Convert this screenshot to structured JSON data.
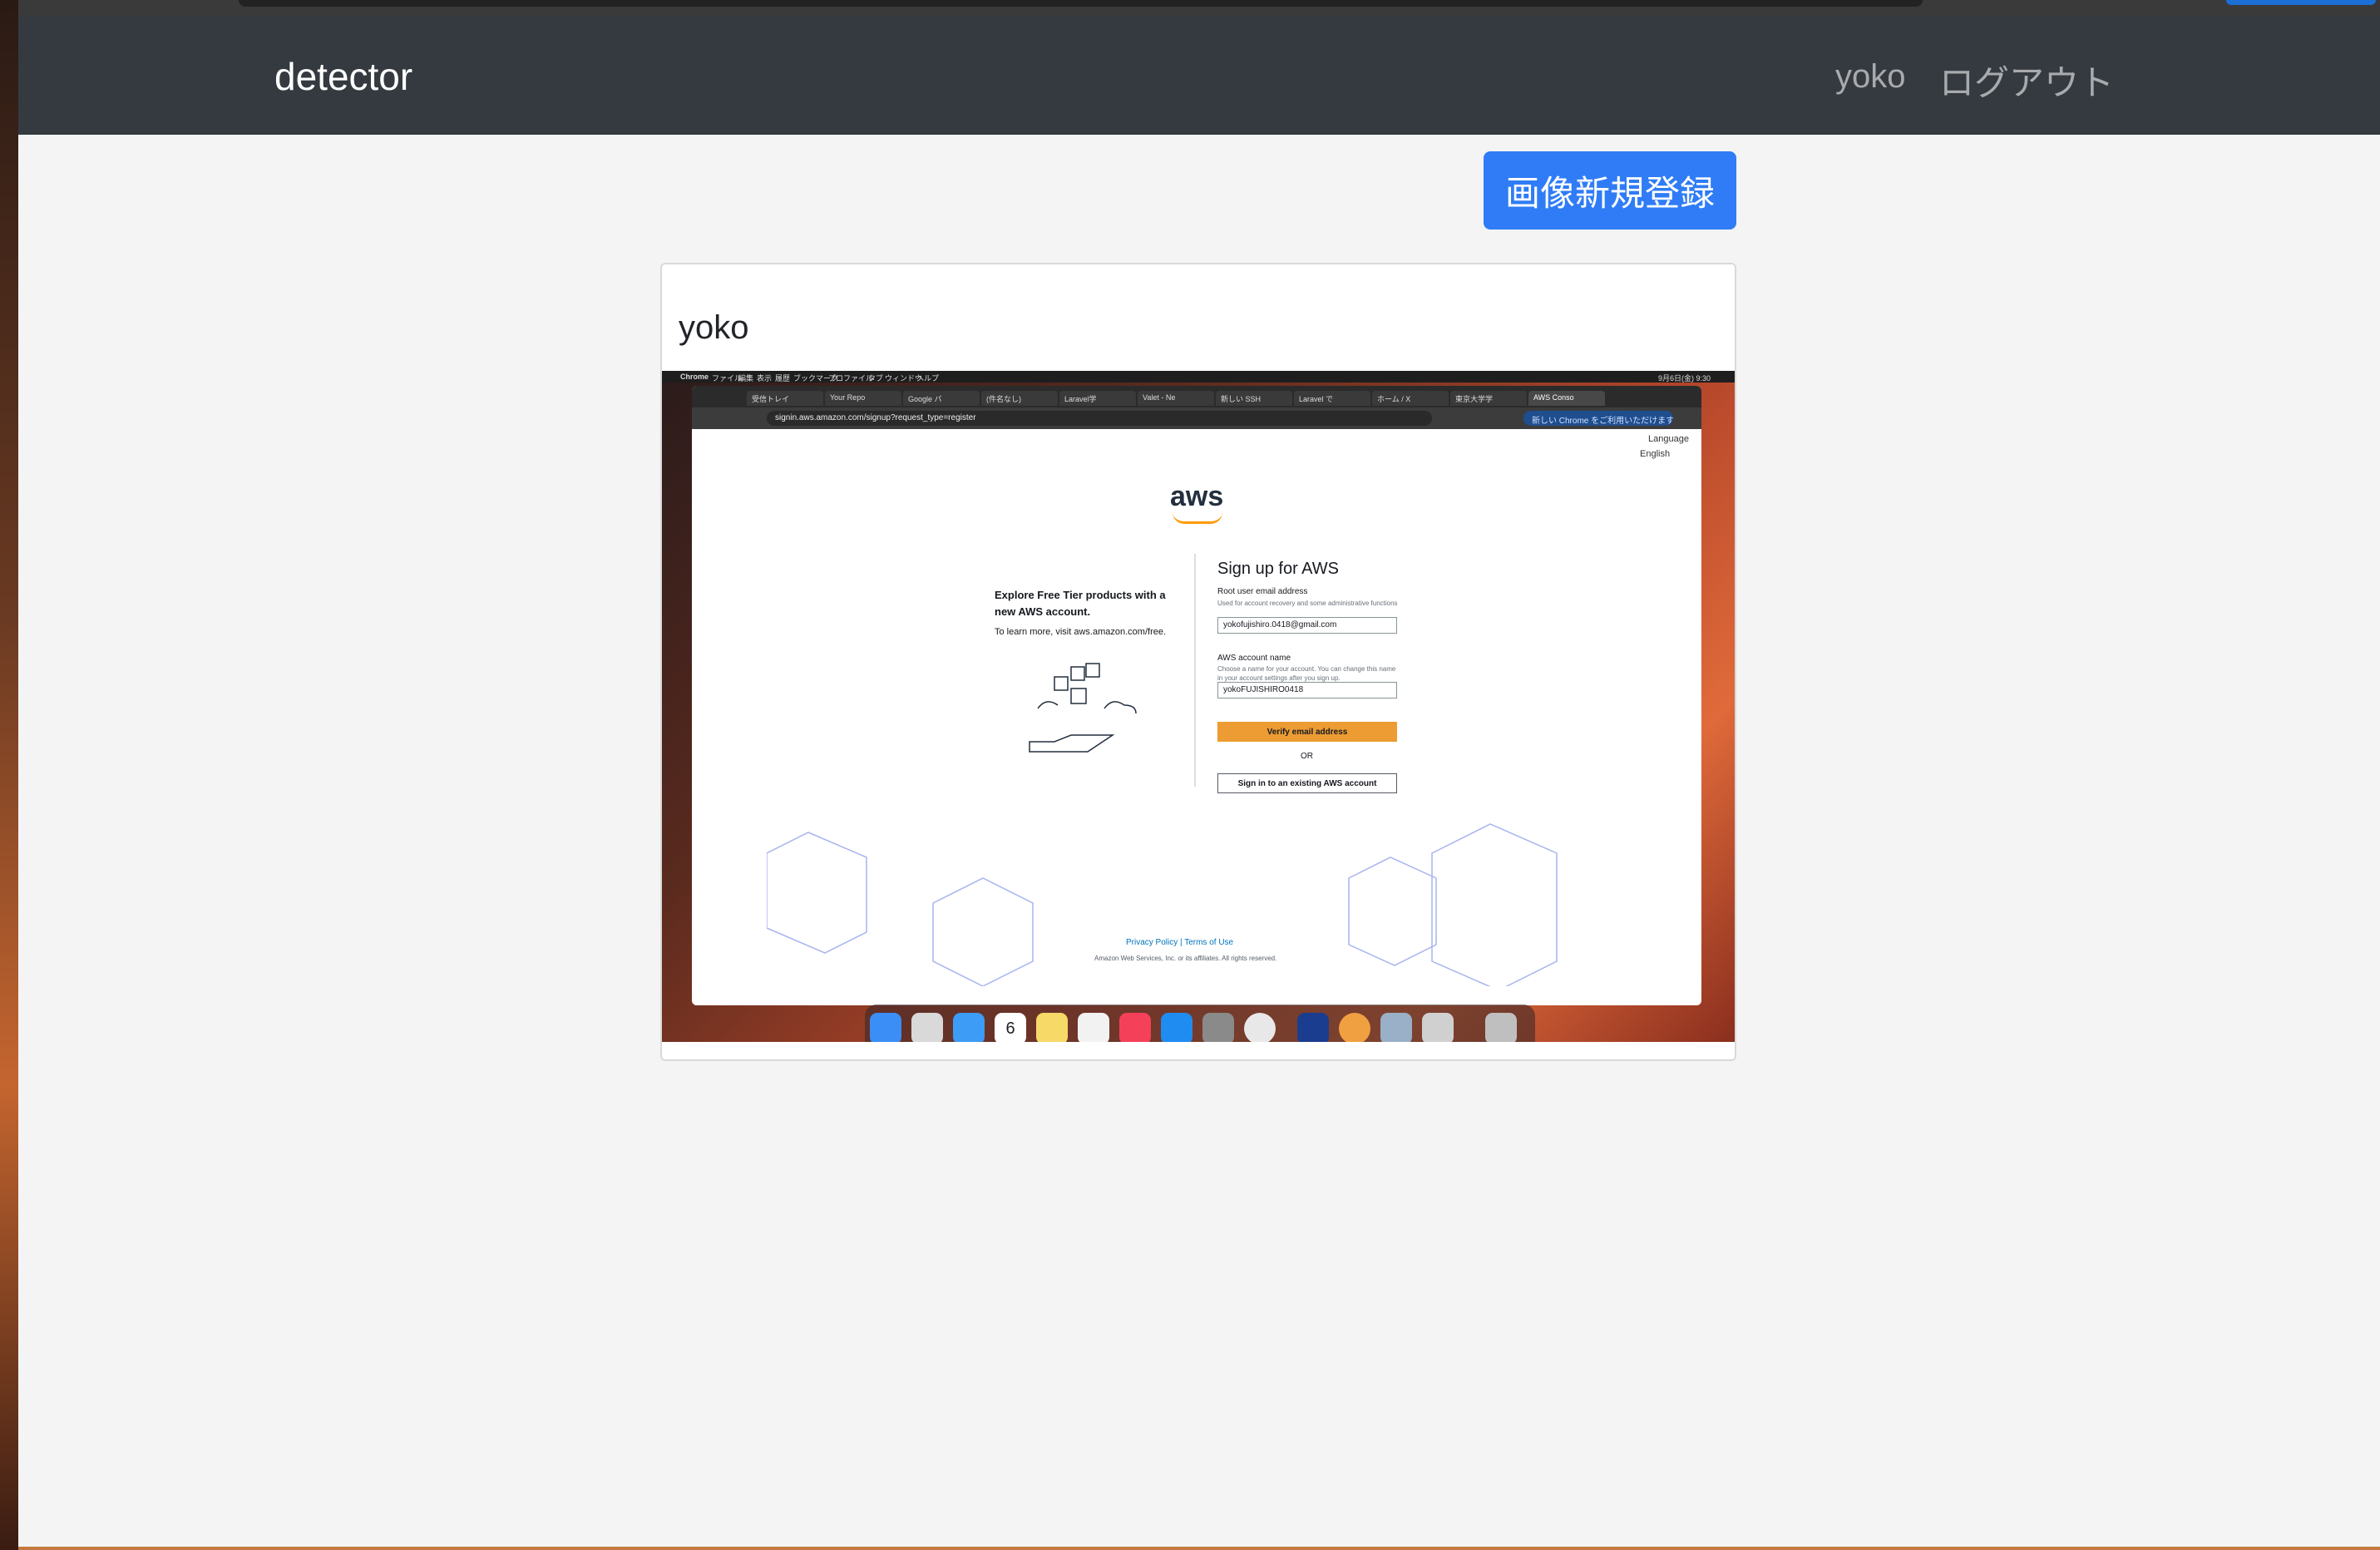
{
  "navbar": {
    "brand": "detector",
    "user": "yoko",
    "logout": "ログアウト"
  },
  "actions": {
    "new_image": "画像新規登録"
  },
  "post": {
    "title": "yoko"
  },
  "embedded": {
    "menubar": {
      "app": "Chrome",
      "items": [
        "ファイル",
        "編集",
        "表示",
        "履歴",
        "ブックマーク",
        "プロファイル",
        "タブ",
        "ウィンドウ",
        "ヘルプ"
      ],
      "clock": "9月6日(金) 9:30"
    },
    "tabs": [
      "受信トレイ",
      "Your Repo",
      "Google バ",
      "(件名なし)",
      "Laravel学",
      "Valet - Ne",
      "新しい SSH",
      "Laravel で",
      "ホーム / X",
      "東京大学学",
      "AWS Conso"
    ],
    "url": "signin.aws.amazon.com/signup?request_type=register",
    "update_notice": "新しい Chrome をご利用いただけます",
    "language_label": "Language",
    "language_value": "English",
    "aws_logo": "aws",
    "promo_heading": "Explore Free Tier products with a new AWS account.",
    "promo_sub": "To learn more, visit aws.amazon.com/free.",
    "signup_title": "Sign up for AWS",
    "email_label": "Root user email address",
    "email_help": "Used for account recovery and some administrative functions",
    "email_value": "yokofujishiro.0418@gmail.com",
    "account_label": "AWS account name",
    "account_help": "Choose a name for your account. You can change this name in your account settings after you sign up.",
    "account_value": "yokoFUJISHIRO0418",
    "verify_button": "Verify email address",
    "or": "OR",
    "signin_button": "Sign in to an existing AWS account",
    "footer_links": "Privacy Policy  |  Terms of Use",
    "footer_copy": "Amazon Web Services, Inc. or its affiliates. All rights reserved.",
    "dock_date": "6"
  }
}
